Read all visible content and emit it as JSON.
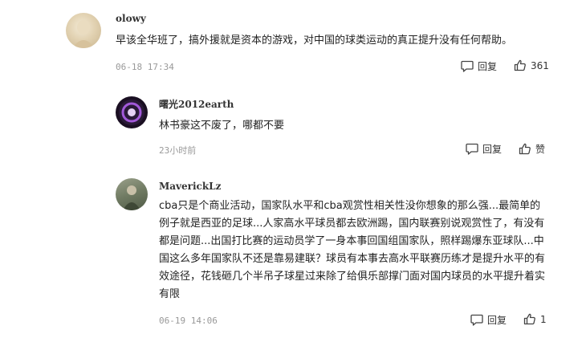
{
  "comments": [
    {
      "username": "olowy",
      "text": "早该全华班了，搞外援就是资本的游戏，对中国的球类运动的真正提升没有任何帮助。",
      "time": "06-18 17:34",
      "reply_label": "回复",
      "like_count": "361"
    },
    {
      "username": "曙光2012earth",
      "text": "林书豪这不废了，哪都不要",
      "time": "23小时前",
      "reply_label": "回复",
      "like_label": "赞"
    },
    {
      "username": "MaverickLz",
      "text": "cba只是个商业活动，国家队水平和cba观赏性相关性没你想象的那么强...最简单的例子就是西亚的足球...人家高水平球员都去欧洲踢，国内联赛别说观赏性了，有没有都是问题...出国打比赛的运动员学了一身本事回国组国家队，照样踢爆东亚球队...中国这么多年国家队不还是靠易建联？球员有本事去高水平联赛历练才是提升水平的有效途径，花钱砸几个半吊子球星过来除了给俱乐部撑门面对国内球员的水平提升着实有限",
      "time": "06-19 14:06",
      "reply_label": "回复",
      "like_count": "1"
    }
  ],
  "icons": {
    "reply": "comment-bubble-icon",
    "like": "thumbs-up-icon"
  },
  "colors": {
    "text": "#222222",
    "meta": "#999999",
    "icon": "#444444"
  }
}
